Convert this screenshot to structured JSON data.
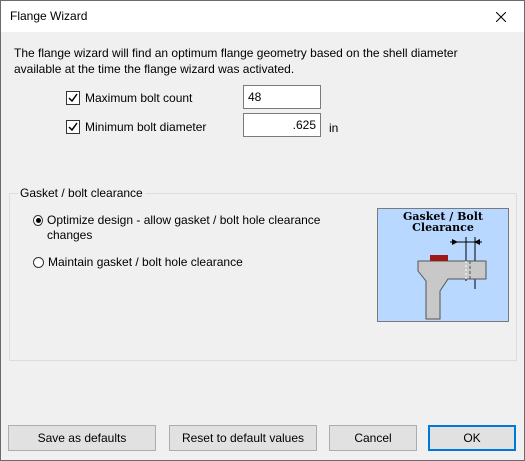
{
  "window": {
    "title": "Flange Wizard"
  },
  "intro": "The flange wizard will find an optimum flange geometry based on the shell diameter available at the time the flange wizard was activated.",
  "max_bolt_count": {
    "label": "Maximum bolt count",
    "checked": true,
    "value": "48"
  },
  "min_bolt_diameter": {
    "label": "Minimum bolt diameter",
    "checked": true,
    "value": ".625",
    "unit": "in"
  },
  "gasket_group": {
    "label": "Gasket / bolt clearance",
    "options": [
      {
        "label": "Optimize design - allow gasket / bolt hole clearance changes",
        "selected": true
      },
      {
        "label": "Maintain gasket / bolt hole clearance",
        "selected": false
      }
    ],
    "diagram": {
      "line1": "Gasket / Bolt",
      "line2": "Clearance",
      "background": "#b8d8ff",
      "gasket_color": "#a01818"
    }
  },
  "buttons": {
    "save_defaults": "Save as defaults",
    "reset_defaults": "Reset to default values",
    "cancel": "Cancel",
    "ok": "OK"
  },
  "colors": {
    "accent": "#0078d7"
  }
}
